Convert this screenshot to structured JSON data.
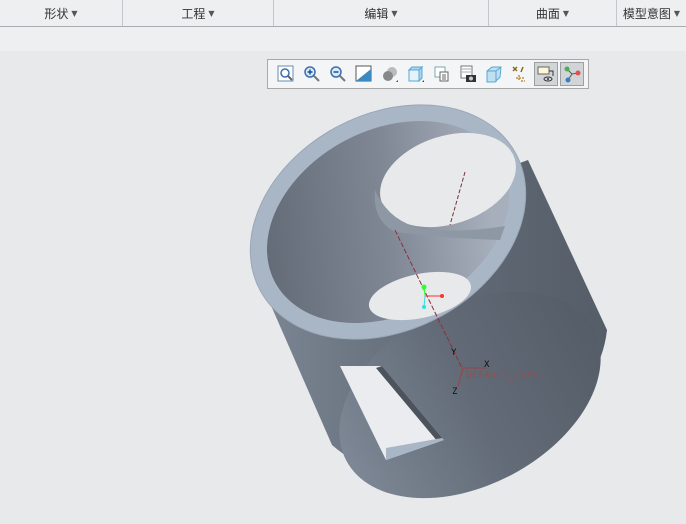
{
  "ribbon": {
    "groups": [
      {
        "label": "形状"
      },
      {
        "label": "工程"
      },
      {
        "label": "编辑"
      },
      {
        "label": "曲面"
      },
      {
        "label": "模型意图"
      }
    ]
  },
  "view_toolbar": {
    "buttons": [
      {
        "icon": "refit-icon"
      },
      {
        "icon": "zoom-in-icon"
      },
      {
        "icon": "zoom-out-icon"
      },
      {
        "icon": "repaint-icon"
      },
      {
        "icon": "display-style-icon"
      },
      {
        "icon": "saved-orientations-icon"
      },
      {
        "icon": "view-manager-icon"
      },
      {
        "icon": "perspective-view-icon"
      },
      {
        "icon": "section-icon"
      },
      {
        "icon": "datum-display-icon"
      },
      {
        "icon": "annotation-display-icon",
        "active": true
      },
      {
        "icon": "spin-center-icon",
        "active": true
      }
    ]
  },
  "model": {
    "csys_label": "DEFAULT_CSYS",
    "axis_x": "X",
    "axis_y": "Y",
    "axis_z": "Z",
    "body_color": "#6e7884",
    "rim_color": "#a9b6c6"
  }
}
